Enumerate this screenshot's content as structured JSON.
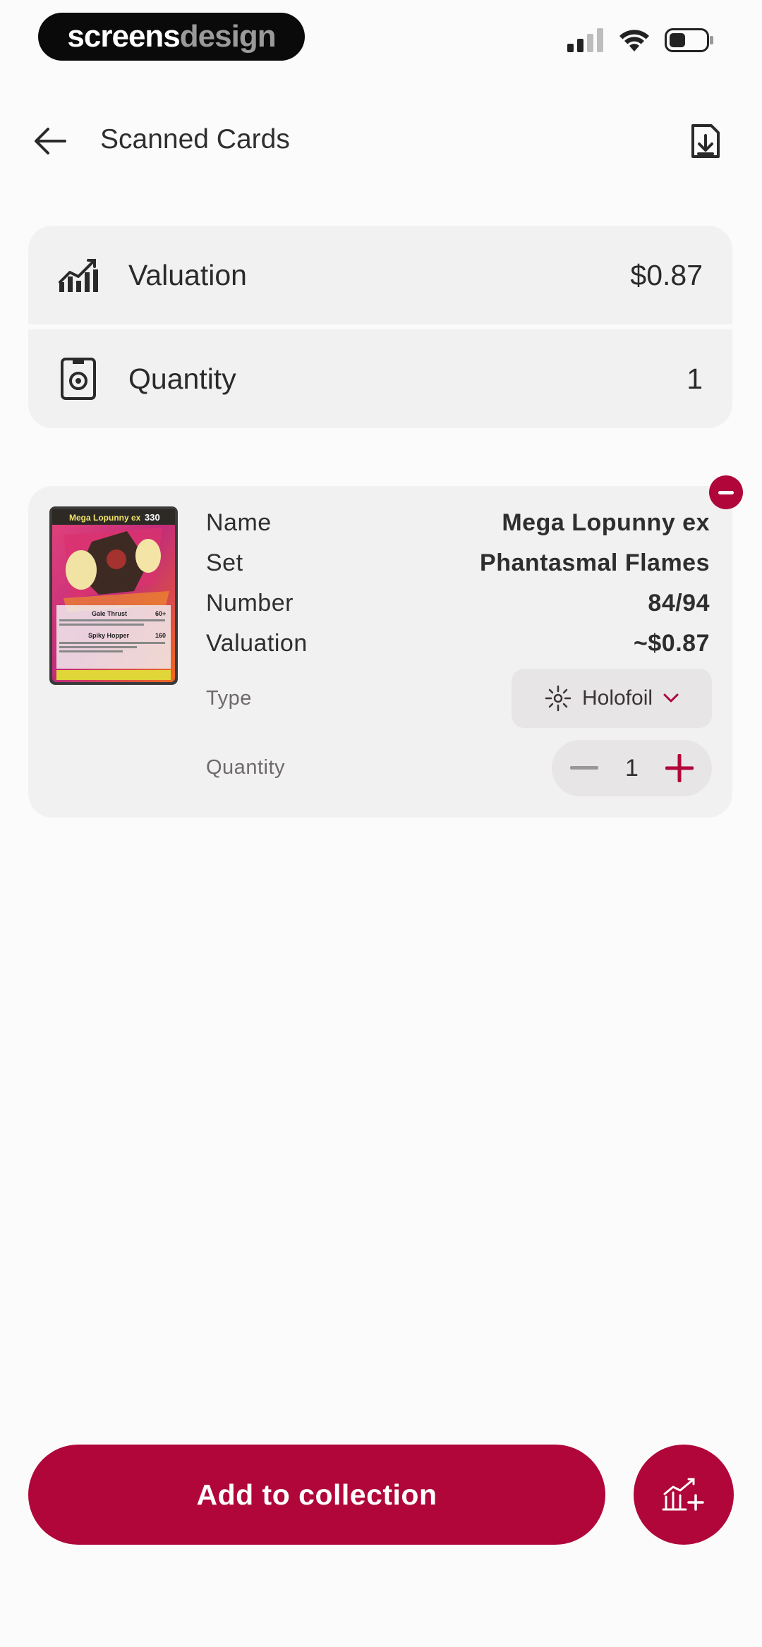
{
  "status_bar": {
    "brand_part1": "screens",
    "brand_part2": "design",
    "icons": [
      "signal-icon",
      "wifi-icon",
      "battery-icon"
    ]
  },
  "header": {
    "title": "Scanned Cards",
    "back_icon": "arrow-left-icon",
    "export_icon": "file-download-icon"
  },
  "summary": {
    "valuation_label": "Valuation",
    "valuation_value": "$0.87",
    "quantity_label": "Quantity",
    "quantity_value": "1"
  },
  "card": {
    "image_name": "Mega Lopunny ex",
    "name_label": "Name",
    "name_value": "Mega Lopunny ex",
    "set_label": "Set",
    "set_value": "Phantasmal Flames",
    "number_label": "Number",
    "number_value": "84/94",
    "valuation_label": "Valuation",
    "valuation_value": "~$0.87",
    "type_label": "Type",
    "type_value": "Holofoil",
    "quantity_label": "Quantity",
    "quantity_value": "1",
    "thumb_text": {
      "title": "Mega Lopunny ex",
      "hp": "330",
      "attack1": "Gale Thrust",
      "attack1_dmg": "60+",
      "attack2": "Spiky Hopper",
      "attack2_dmg": "160"
    }
  },
  "footer": {
    "cta_label": "Add to collection",
    "fab_icon": "chart-add-icon"
  },
  "colors": {
    "accent": "#b0063a",
    "surface": "#f2f1f2",
    "background": "#fcfbfc"
  }
}
